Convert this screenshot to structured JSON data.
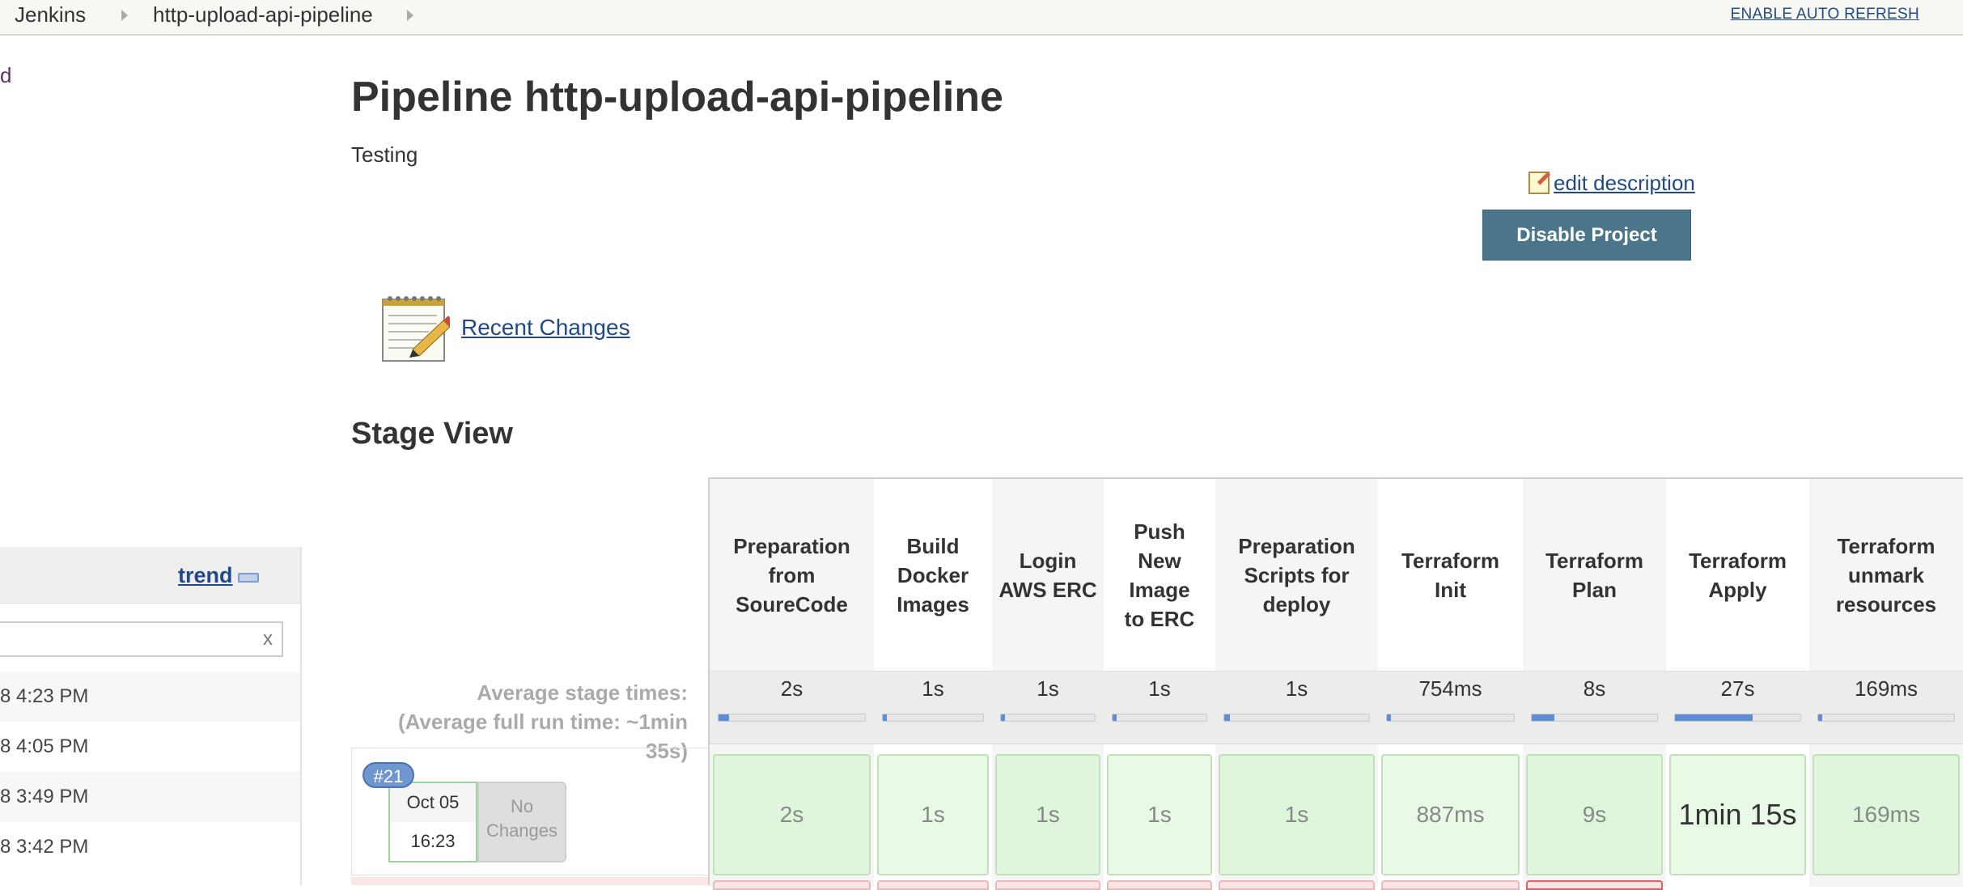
{
  "breadcrumb": {
    "home": "Jenkins",
    "job": "http-upload-api-pipeline"
  },
  "auto_refresh": "ENABLE AUTO REFRESH",
  "sidebar": {
    "partial_link": "d"
  },
  "build_history": {
    "trend": "trend",
    "filter_clear": "x",
    "rows": [
      "8 4:23 PM",
      "8 4:05 PM",
      "8 3:49 PM",
      "8 3:42 PM"
    ]
  },
  "main": {
    "title": "Pipeline http-upload-api-pipeline",
    "description": "Testing",
    "edit_description": "edit description",
    "disable_button": "Disable Project",
    "recent_changes": "Recent Changes",
    "stage_view_title": "Stage View"
  },
  "stage_view": {
    "avg_label_line1": "Average stage times:",
    "avg_label_line2": "(Average full run time: ~1min",
    "avg_label_line3": "35s)",
    "stages": [
      {
        "name": "Preparation from SoureCode",
        "avg": "2s",
        "avg_fraction": 0.07,
        "run": "2s"
      },
      {
        "name": "Build Docker Images",
        "avg": "1s",
        "avg_fraction": 0.04,
        "run": "1s"
      },
      {
        "name": "Login AWS ERC",
        "avg": "1s",
        "avg_fraction": 0.04,
        "run": "1s"
      },
      {
        "name": "Push New Image to ERC",
        "avg": "1s",
        "avg_fraction": 0.04,
        "run": "1s"
      },
      {
        "name": "Preparation Scripts for deploy",
        "avg": "1s",
        "avg_fraction": 0.04,
        "run": "1s"
      },
      {
        "name": "Terraform Init",
        "avg": "754ms",
        "avg_fraction": 0.03,
        "run": "887ms"
      },
      {
        "name": "Terraform Plan",
        "avg": "8s",
        "avg_fraction": 0.18,
        "run": "9s"
      },
      {
        "name": "Terraform Apply",
        "avg": "27s",
        "avg_fraction": 0.62,
        "run": "1min 15s"
      },
      {
        "name": "Terraform unmark resources",
        "avg": "169ms",
        "avg_fraction": 0.02,
        "run": "169ms"
      }
    ],
    "build": {
      "number": "#21",
      "date": "Oct 05",
      "time": "16:23",
      "changes": "No Changes"
    }
  },
  "colors": {
    "accent": "#4b758b",
    "success_cell": "#dff5dc",
    "failed_row": "#fde6e6",
    "link": "#204a87"
  }
}
